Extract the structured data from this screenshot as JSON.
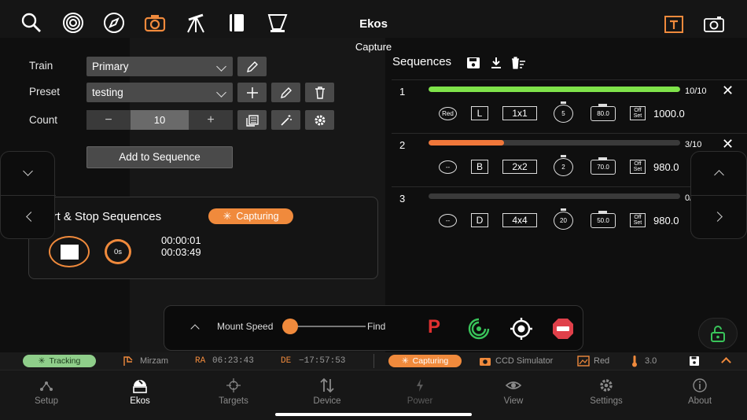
{
  "app": {
    "title": "Ekos",
    "subtitle": "Capture"
  },
  "form": {
    "train_label": "Train",
    "train_value": "Primary",
    "preset_label": "Preset",
    "preset_value": "testing",
    "count_label": "Count",
    "count_minus": "−",
    "count_value": "10",
    "count_plus": "+",
    "add_button": "Add to Sequence"
  },
  "capture": {
    "title": "Start & Stop Sequences",
    "status": "Capturing",
    "countdown": "0s",
    "elapsed": "00:00:01",
    "remaining": "00:03:49"
  },
  "sequences": {
    "title": "Sequences",
    "rows": [
      {
        "num": "1",
        "progress_text": "10/10",
        "progress": 1.0,
        "bar_color": "#7fe34a",
        "filter": "Red",
        "type": "L",
        "binning": "1x1",
        "exposure": "5",
        "gain": "80.0",
        "offset_label": "Off Set",
        "offset": "1000.0"
      },
      {
        "num": "2",
        "progress_text": "3/10",
        "progress": 0.3,
        "bar_color": "#f0773a",
        "filter": "--",
        "type": "B",
        "binning": "2x2",
        "exposure": "2",
        "gain": "70.0",
        "offset_label": "Off Set",
        "offset": "980.0"
      },
      {
        "num": "3",
        "progress_text": "0/10",
        "progress": 0.0,
        "bar_color": "#3a3a3a",
        "filter": "--",
        "type": "D",
        "binning": "4x4",
        "exposure": "20",
        "gain": "50.0",
        "offset_label": "Off Set",
        "offset": "980.0"
      }
    ]
  },
  "mount": {
    "speed_label": "Mount Speed",
    "speed_value": 0.0,
    "find_label": "Find",
    "park_label": "P"
  },
  "status": {
    "tracking": "Tracking",
    "target": "Mirzam",
    "ra_label": "RA",
    "ra": "06:23:43",
    "de_label": "DE",
    "de": "−17:57:53",
    "capturing": "Capturing",
    "camera": "CCD Simulator",
    "filter": "Red",
    "temp": "3.0"
  },
  "tabs": [
    "Setup",
    "Ekos",
    "Targets",
    "Device",
    "Power",
    "View",
    "Settings",
    "About"
  ],
  "colors": {
    "accent": "#f08a3c",
    "green": "#7fe34a",
    "tracking": "#8fce8a",
    "park": "#e03030",
    "stop": "#e0404a"
  }
}
